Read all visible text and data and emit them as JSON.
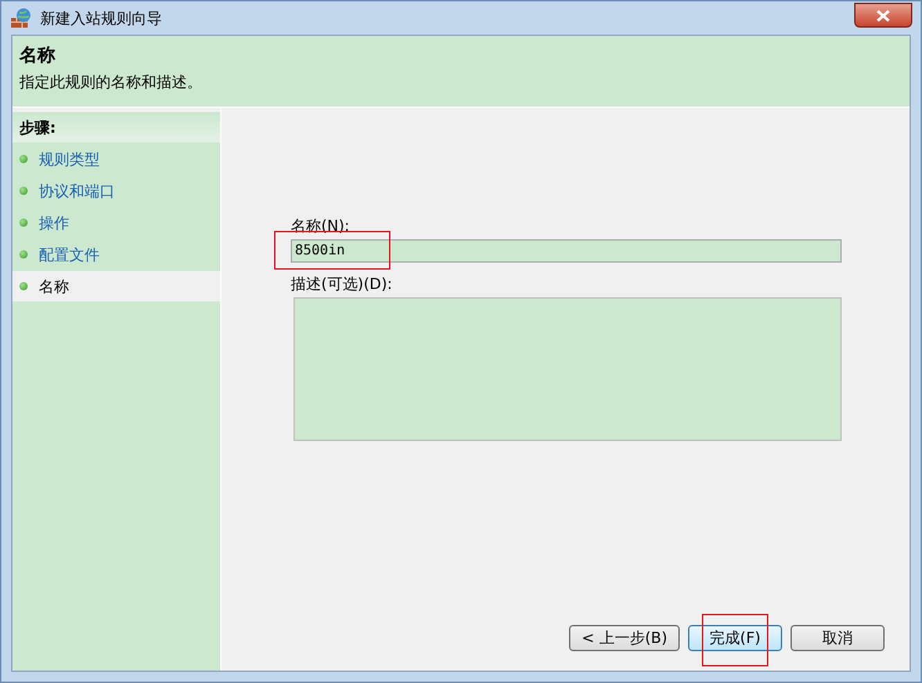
{
  "window": {
    "title": "新建入站规则向导"
  },
  "header": {
    "title": "名称",
    "description": "指定此规则的名称和描述。"
  },
  "steps": {
    "title": "步骤:",
    "items": [
      {
        "label": "规则类型",
        "selected": false
      },
      {
        "label": "协议和端口",
        "selected": false
      },
      {
        "label": "操作",
        "selected": false
      },
      {
        "label": "配置文件",
        "selected": false
      },
      {
        "label": "名称",
        "selected": true
      }
    ]
  },
  "form": {
    "name_label": "名称(N):",
    "name_value": "8500in",
    "name_highlighted": true,
    "description_label": "描述(可选)(D):"
  },
  "buttons": [
    {
      "label": "< 上一步(B)",
      "default": false,
      "highlighted": false
    },
    {
      "label": "完成(F)",
      "default": true,
      "highlighted": true
    },
    {
      "label": "取消",
      "default": false,
      "highlighted": false
    }
  ]
}
